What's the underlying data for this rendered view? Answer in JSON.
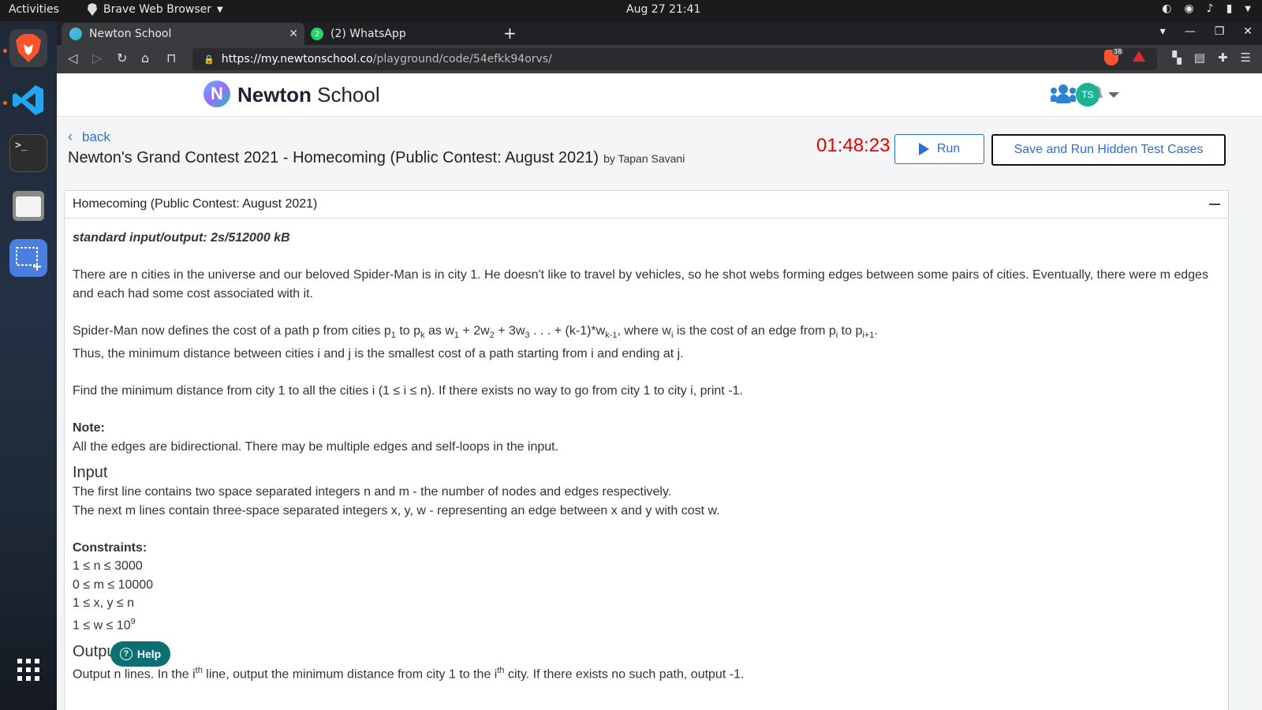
{
  "topbar": {
    "activities": "Activities",
    "app_name": "Brave Web Browser",
    "clock": "Aug 27  21:41"
  },
  "browser": {
    "tabs": [
      {
        "label": "Newton School",
        "active": true
      },
      {
        "label": "(2) WhatsApp",
        "active": false
      }
    ],
    "whatsapp_badge": "2",
    "url_host": "https://my.newtonschool.co",
    "url_path": "/playground/code/54efkk94orvs/",
    "shield_count": "38"
  },
  "site": {
    "brand_bold": "Newton",
    "brand_rest": "School",
    "logo_letter": "N",
    "avatar_initials": "TS",
    "back_label": "back",
    "contest_title": "Newton's Grand Contest 2021 - Homecoming (Public Contest: August 2021)",
    "contest_by": "by Tapan Savani",
    "timer": "01:48:23",
    "run_label": "Run",
    "save_label": "Save and Run Hidden Test Cases",
    "help_label": "Help"
  },
  "problem": {
    "card_title": "Homecoming (Public Contest: August 2021)",
    "io_spec": "standard input/output: 2s/512000 kB",
    "para1": "There are n cities in the universe and our beloved Spider-Man is in city 1. He doesn't like to travel by vehicles, so he shot webs forming edges between some pairs of cities. Eventually, there were m edges and each had some cost associated with it.",
    "para2_line2": "Thus, the minimum distance between cities i and j is the smallest cost of a path starting from i and ending at j.",
    "para3": "Find the minimum distance from city 1 to all the cities i (1 ≤ i ≤ n). If there exists no way to go from city 1 to city i, print -1.",
    "note_label": "Note:",
    "note_text": "All the edges are bidirectional. There may be multiple edges and self-loops in the input.",
    "input_head": "Input",
    "input_line1": "The first line contains two space separated integers n and m - the number of nodes and edges respectively.",
    "input_line2": "The next m lines contain three-space separated integers x, y, w - representing an edge between x and y with cost w.",
    "constraints_label": "Constraints:",
    "constraints": [
      "1 ≤ n ≤ 3000",
      "0 ≤ m ≤ 10000",
      "1 ≤ x, y ≤ n"
    ],
    "constraint_w_base": "1 ≤ w ≤ 10",
    "constraint_w_exp": "9",
    "output_head": "Output"
  }
}
